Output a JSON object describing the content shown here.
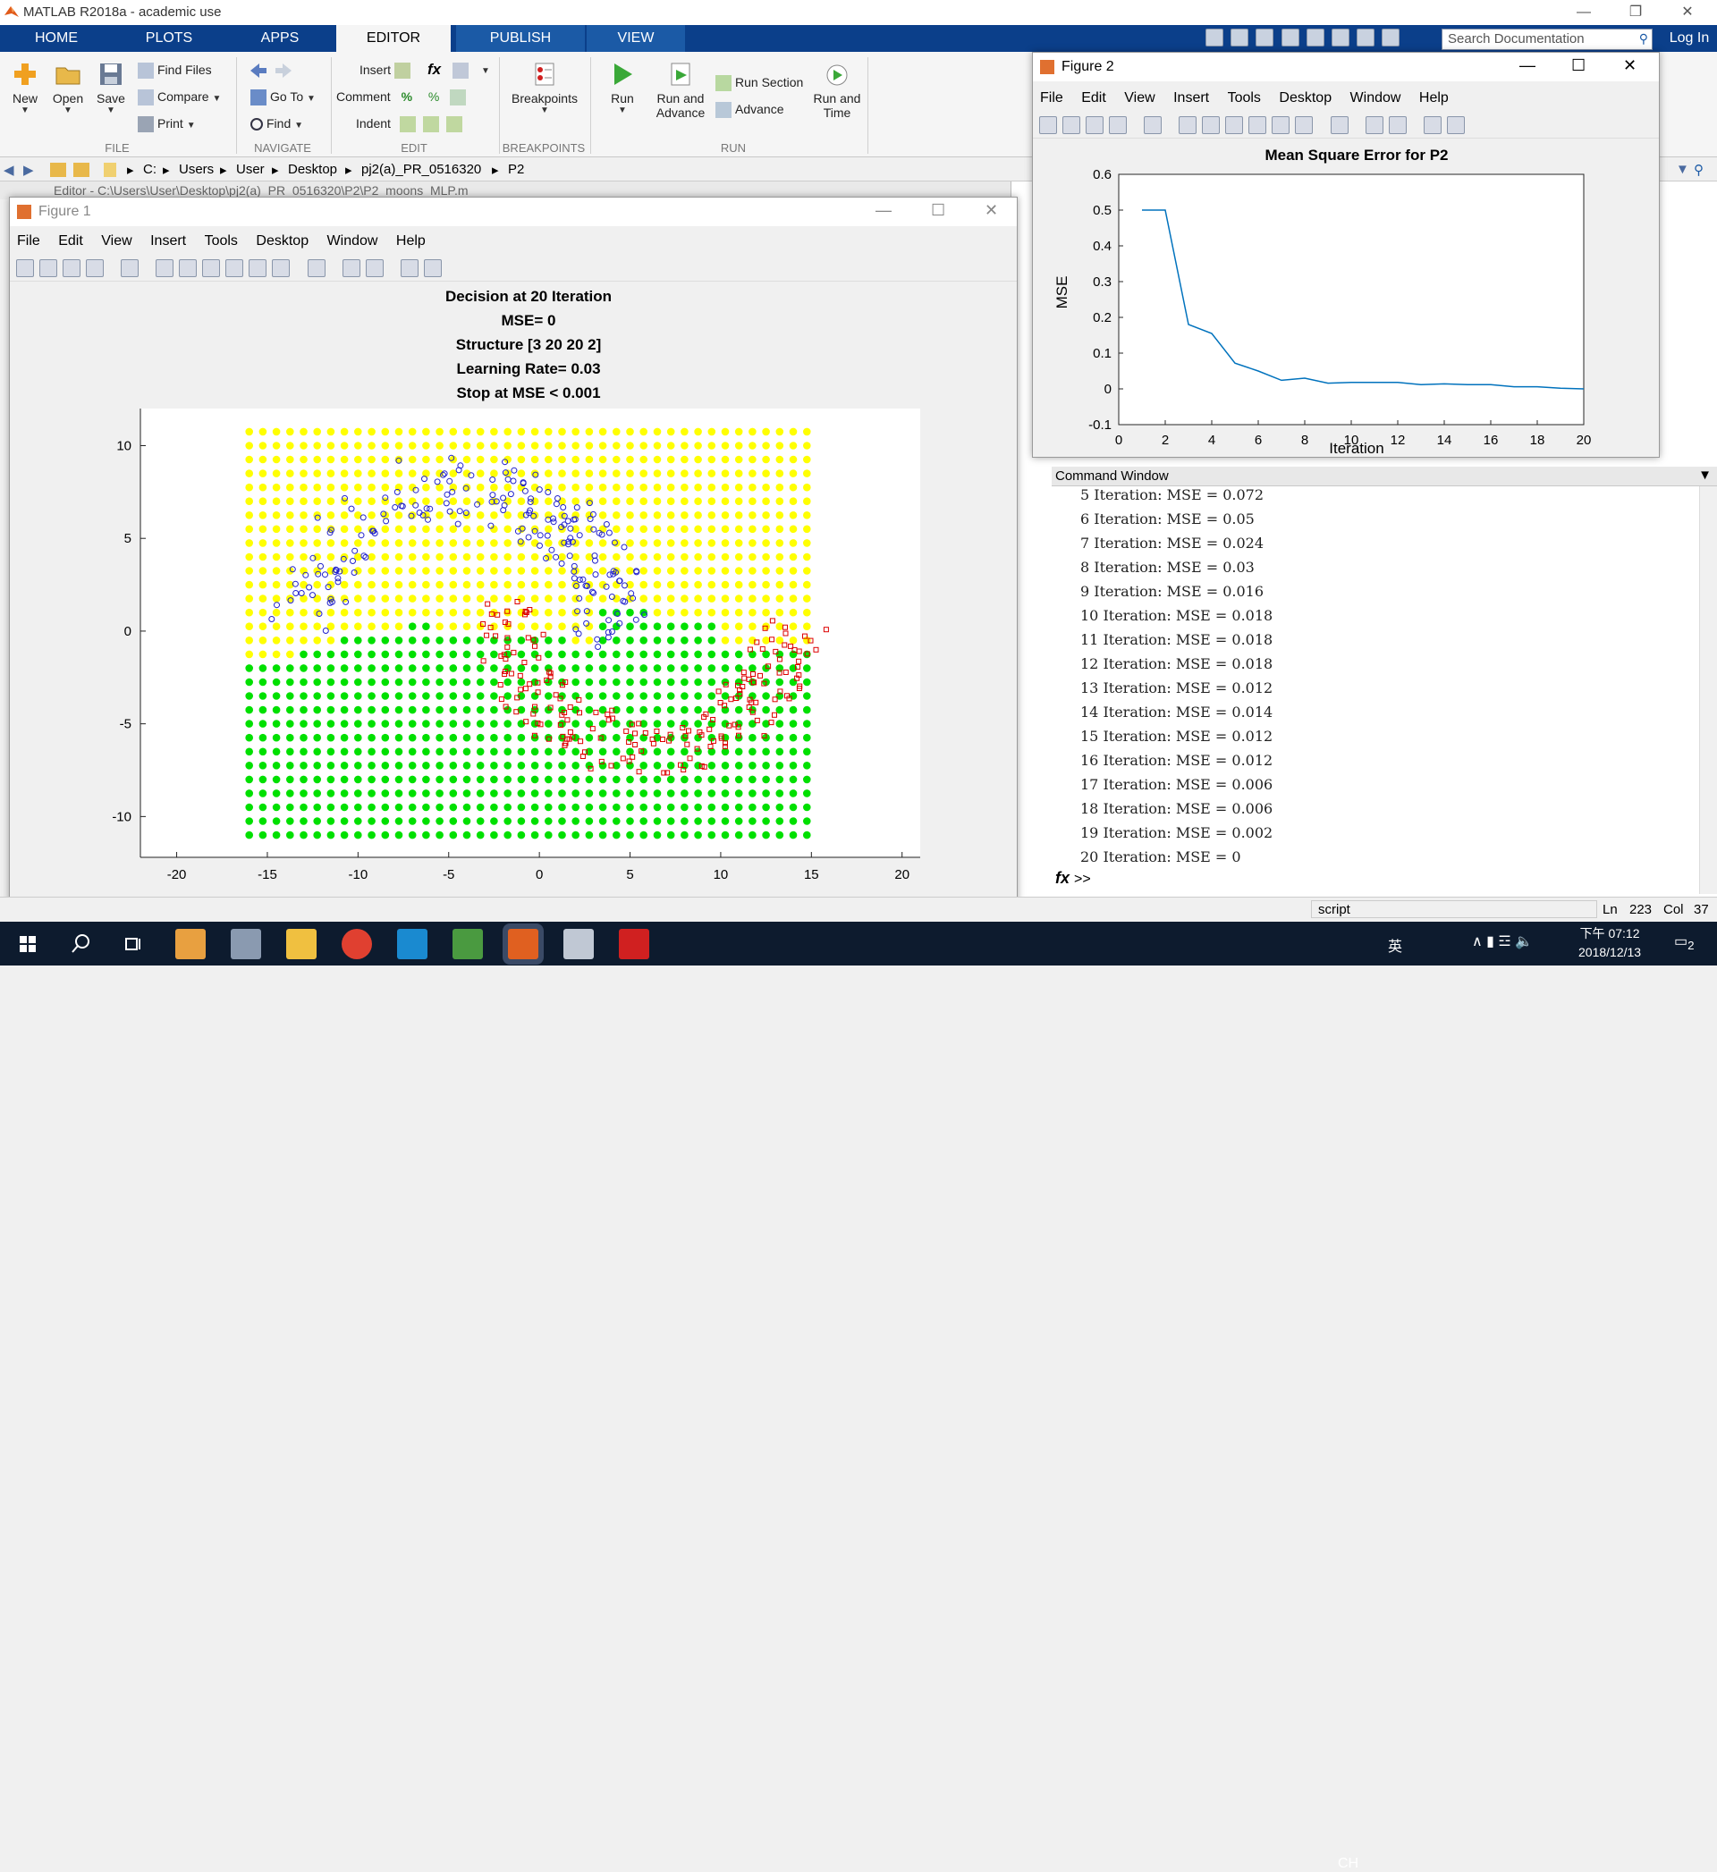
{
  "app": {
    "title": "MATLAB R2018a - academic use"
  },
  "ribbon": {
    "tabs": [
      "HOME",
      "PLOTS",
      "APPS",
      "EDITOR",
      "PUBLISH",
      "VIEW"
    ],
    "active_tab": "EDITOR",
    "search_placeholder": "Search Documentation",
    "login": "Log In",
    "file": {
      "new": "New",
      "open": "Open",
      "save": "Save",
      "find_files": "Find Files",
      "compare": "Compare",
      "print": "Print",
      "group": "FILE"
    },
    "navigate": {
      "goto": "Go To",
      "find": "Find",
      "group": "NAVIGATE"
    },
    "edit": {
      "insert": "Insert",
      "comment": "Comment",
      "indent": "Indent",
      "fx": "fx",
      "group": "EDIT"
    },
    "breakpoints": {
      "label": "Breakpoints",
      "group": "BREAKPOINTS"
    },
    "run": {
      "run": "Run",
      "run_and_advance_1": "Run and",
      "run_and_advance_2": "Advance",
      "run_section": "Run Section",
      "advance": "Advance",
      "run_and_time_1": "Run and",
      "run_and_time_2": "Time",
      "group": "RUN"
    }
  },
  "address": {
    "segments": [
      "C:",
      "Users",
      "User",
      "Desktop",
      "pj2(a)_PR_0516320",
      "P2"
    ]
  },
  "editor_strip": "Editor - C:\\Users\\User\\Desktop\\pj2(a)_PR_0516320\\P2\\P2_moons_MLP.m",
  "figure1": {
    "title": "Figure 1",
    "menu": [
      "File",
      "Edit",
      "View",
      "Insert",
      "Tools",
      "Desktop",
      "Window",
      "Help"
    ],
    "plot_title": [
      "Decision at 20 Iteration",
      "MSE= 0",
      "Structure [3 20 20 2]",
      "Learning Rate= 0.03",
      "Stop at MSE < 0.001"
    ],
    "xticks": [
      "-20",
      "-15",
      "-10",
      "-5",
      "0",
      "5",
      "10",
      "15",
      "20"
    ],
    "yticks": [
      "10",
      "5",
      "0",
      "-5",
      "-10"
    ],
    "colors": {
      "class_a_region": "#ffff00",
      "class_b_region": "#00e000",
      "class_a_points": "#2222cc",
      "class_b_points": "#dd0000"
    }
  },
  "figure2": {
    "title": "Figure 2",
    "menu": [
      "File",
      "Edit",
      "View",
      "Insert",
      "Tools",
      "Desktop",
      "Window",
      "Help"
    ]
  },
  "chart_data": {
    "type": "line",
    "title": "Mean Square Error for P2",
    "xlabel": "Iteration",
    "ylabel": "MSE",
    "xlim": [
      0,
      20
    ],
    "ylim": [
      -0.1,
      0.6
    ],
    "xticks": [
      "0",
      "2",
      "4",
      "6",
      "8",
      "10",
      "12",
      "14",
      "16",
      "18",
      "20"
    ],
    "yticks": [
      "0.6",
      "0.5",
      "0.4",
      "0.3",
      "0.2",
      "0.1",
      "0",
      "-0.1"
    ],
    "x": [
      1,
      2,
      3,
      4,
      5,
      6,
      7,
      8,
      9,
      10,
      11,
      12,
      13,
      14,
      15,
      16,
      17,
      18,
      19,
      20
    ],
    "y": [
      0.5,
      0.5,
      0.18,
      0.155,
      0.072,
      0.05,
      0.024,
      0.03,
      0.016,
      0.018,
      0.018,
      0.018,
      0.012,
      0.014,
      0.012,
      0.012,
      0.006,
      0.006,
      0.002,
      0
    ],
    "color": "#0072bd"
  },
  "command_window": {
    "title": "Command Window",
    "lines": [
      "5 Iteration: MSE = 0.072",
      "6 Iteration: MSE = 0.05",
      "7 Iteration: MSE = 0.024",
      "8 Iteration: MSE = 0.03",
      "9 Iteration: MSE = 0.016",
      "10 Iteration: MSE = 0.018",
      "11 Iteration: MSE = 0.018",
      "12 Iteration: MSE = 0.018",
      "13 Iteration: MSE = 0.012",
      "14 Iteration: MSE = 0.014",
      "15 Iteration: MSE = 0.012",
      "16 Iteration: MSE = 0.012",
      "17 Iteration: MSE = 0.006",
      "18 Iteration: MSE = 0.006",
      "19 Iteration: MSE = 0.002",
      "20 Iteration: MSE = 0"
    ],
    "prompt": ">>"
  },
  "status": {
    "mode": "script",
    "ln_label": "Ln",
    "ln": "223",
    "col_label": "Col",
    "col": "37"
  },
  "taskbar": {
    "ime": "CH",
    "ime2": "英",
    "time": "下午 07:12",
    "date": "2018/12/13",
    "notifications": "2"
  }
}
